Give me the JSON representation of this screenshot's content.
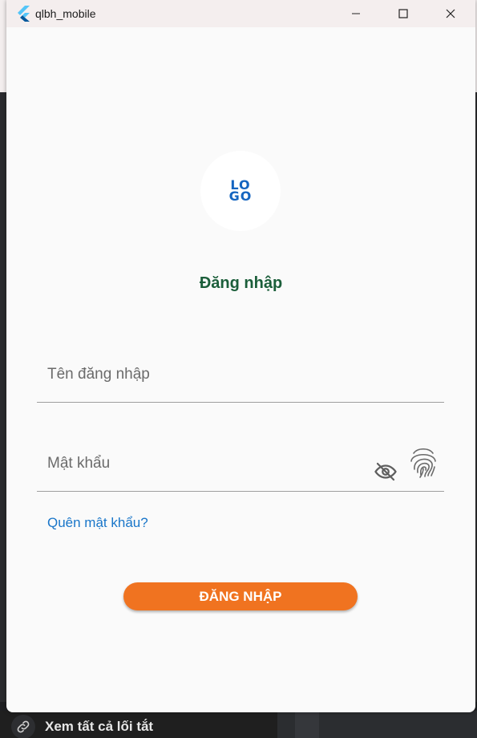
{
  "window": {
    "title": "qlbh_mobile",
    "controls": [
      "minimize",
      "maximize",
      "close"
    ]
  },
  "logo": {
    "line1": "LO",
    "line2": "GO"
  },
  "login": {
    "heading": "Đăng nhập",
    "username_placeholder": "Tên đăng nhập",
    "username_value": "",
    "password_placeholder": "Mật khẩu",
    "password_value": "",
    "forgot_label": "Quên mật khẩu?",
    "submit_label": "ĐĂNG NHẬP"
  },
  "background": {
    "shortcut_label": "Xem tất cả lối tắt"
  },
  "icons": {
    "app": "flutter-icon",
    "password_visibility": "eye-off-icon",
    "biometric": "fingerprint-icon",
    "shortcut": "link-icon"
  },
  "colors": {
    "heading": "#1b5e3a",
    "link": "#1976c9",
    "button": "#f07320",
    "logo": "#1565c0",
    "window_bg": "#fafafa",
    "titlebar_bg": "#f4eeee"
  }
}
